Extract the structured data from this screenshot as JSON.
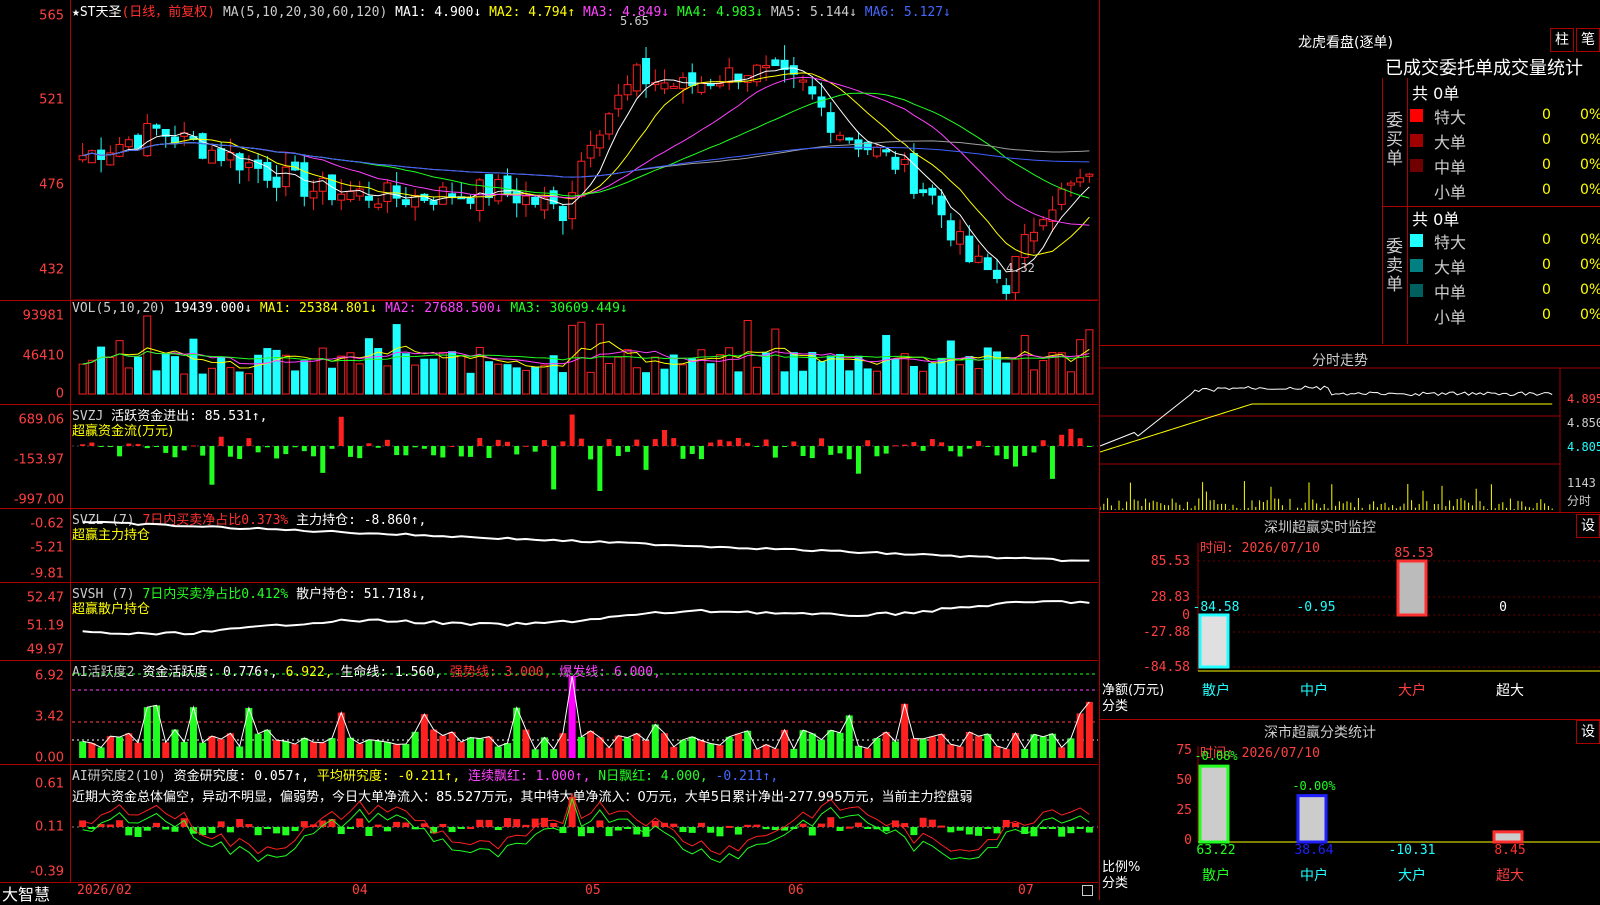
{
  "price": {
    "header": {
      "star": "★",
      "name": "ST天圣",
      "mode": "(日线，前复权)",
      "ma_label": "MA(5,10,20,30,60,120)",
      "ma1": "MA1: 4.900↓",
      "ma2": "MA2: 4.794↑",
      "ma3": "MA3: 4.849↓",
      "ma4": "MA4: 4.983↓",
      "ma5": "MA5: 5.144↓",
      "ma6": "MA6: 5.127↓"
    },
    "yticks": [
      "565",
      "521",
      "476",
      "432"
    ],
    "high_label": "5.65",
    "low_label": "4.32"
  },
  "vol": {
    "header": {
      "label": "VOL(5,10,20)",
      "v": "19439.000↓",
      "ma1": "MA1: 25384.801↓",
      "ma2": "MA2: 27688.500↓",
      "ma3": "MA3: 30609.449↓"
    },
    "yticks": [
      "93981",
      "46410",
      "0"
    ]
  },
  "svzj": {
    "header": {
      "label": "SVZJ",
      "text": "活跃资金进出: 85.531↑,"
    },
    "sub": "超赢资金流(万元)",
    "yticks": [
      "689.06",
      "-153.97",
      "-997.00"
    ]
  },
  "svzl": {
    "header": {
      "label": "SVZL (7)",
      "t1": "7日内买卖净占比0.373%",
      "t2": "主力持仓: -8.860↑,"
    },
    "sub": "超赢主力持仓",
    "yticks": [
      "-0.62",
      "-5.21",
      "-9.81"
    ]
  },
  "svsh": {
    "header": {
      "label": "SVSH (7)",
      "t1": "7日内买卖净占比0.412%",
      "t2": "散户持仓: 51.718↓,"
    },
    "sub": "超赢散户持仓",
    "yticks": [
      "52.47",
      "51.19",
      "49.97"
    ]
  },
  "ai1": {
    "header": {
      "label": "AI活跃度2",
      "t1": "资金活跃度: 0.776↑,",
      "t2": "6.922,",
      "t3": "生命线: 1.560,",
      "t4": "强势线: 3.000,",
      "t5": "爆发线: 6.000,"
    },
    "yticks": [
      "6.92",
      "3.42",
      "0.00"
    ]
  },
  "ai2": {
    "header": {
      "label": "AI研究度2(10)",
      "t1": "资金研究度: 0.057↑,",
      "t2": "平均研究度: -0.211↑,",
      "t3": "连续飘红: 1.000↑,",
      "t4": "N日飘红: 4.000,",
      "t5": "-0.211↑,"
    },
    "comment": "近期大资金总体偏空，异动不明显，偏弱势，今日大单净流入：85.527万元，其中特大单净流入：0万元，大单5日累计净出-277.995万元，当前主力控盘弱",
    "yticks": [
      "0.61",
      "0.11",
      "-0.39"
    ]
  },
  "xaxis": {
    "brand": "大智慧",
    "labels": [
      "2026/02",
      "04",
      "05",
      "06",
      "07"
    ]
  },
  "lhb": {
    "title": "龙虎看盘(逐单)",
    "btn1": "柱",
    "btn2": "笔",
    "heading": "已成交委托单成交量统计",
    "buy": {
      "label": "委买单",
      "total": "共 0单",
      "rows": [
        {
          "name": "特大",
          "n": "0",
          "p": "0%"
        },
        {
          "name": "大单",
          "n": "0",
          "p": "0%"
        },
        {
          "name": "中单",
          "n": "0",
          "p": "0%"
        },
        {
          "name": "小单",
          "n": "0",
          "p": "0%"
        }
      ]
    },
    "sell": {
      "label": "委卖单",
      "total": "共 0单",
      "rows": [
        {
          "name": "特大",
          "n": "0",
          "p": "0%"
        },
        {
          "name": "大单",
          "n": "0",
          "p": "0%"
        },
        {
          "name": "中单",
          "n": "0",
          "p": "0%"
        },
        {
          "name": "小单",
          "n": "0",
          "p": "0%"
        }
      ]
    }
  },
  "intraday": {
    "title": "分时走势",
    "yticks": [
      "4.895",
      "4.850",
      "4.805"
    ],
    "vol_label": "1143",
    "vol_unit": "分时"
  },
  "sz_monitor": {
    "title": "深圳超赢实时监控",
    "btn": "设",
    "time": "时间: 2026/07/10",
    "yticks": [
      "85.53",
      "28.83",
      "0",
      "-27.88",
      "-84.58"
    ],
    "values": [
      {
        "cat": "散户",
        "v": "-84.58"
      },
      {
        "cat": "中户",
        "v": "-0.95"
      },
      {
        "cat": "大户",
        "v": "85.53"
      },
      {
        "cat": "超大",
        "v": "0"
      }
    ],
    "ylabel": "净额(万元)",
    "xlabel": "分类"
  },
  "sz_class": {
    "title": "深市超赢分类统计",
    "btn": "设",
    "time": "时间: 2026/07/10",
    "yticks": [
      "75",
      "50",
      "25",
      "0"
    ],
    "top": [
      "-0.08%",
      "-0.00%"
    ],
    "values": [
      {
        "cat": "散户",
        "v": "63.22"
      },
      {
        "cat": "中户",
        "v": "38.64"
      },
      {
        "cat": "大户",
        "v": "-10.31"
      },
      {
        "cat": "超大",
        "v": "8.45"
      }
    ],
    "ylabel": "比例%",
    "xlabel": "分类"
  },
  "colors": {
    "up": "#ff2020",
    "down": "#20ffff",
    "ma1": "#ffffff",
    "ma2": "#ffff00",
    "ma3": "#ff40ff",
    "ma4": "#20ff20",
    "ma5": "#a0a0a0",
    "ma6": "#4060ff",
    "grid": "#a00000"
  }
}
